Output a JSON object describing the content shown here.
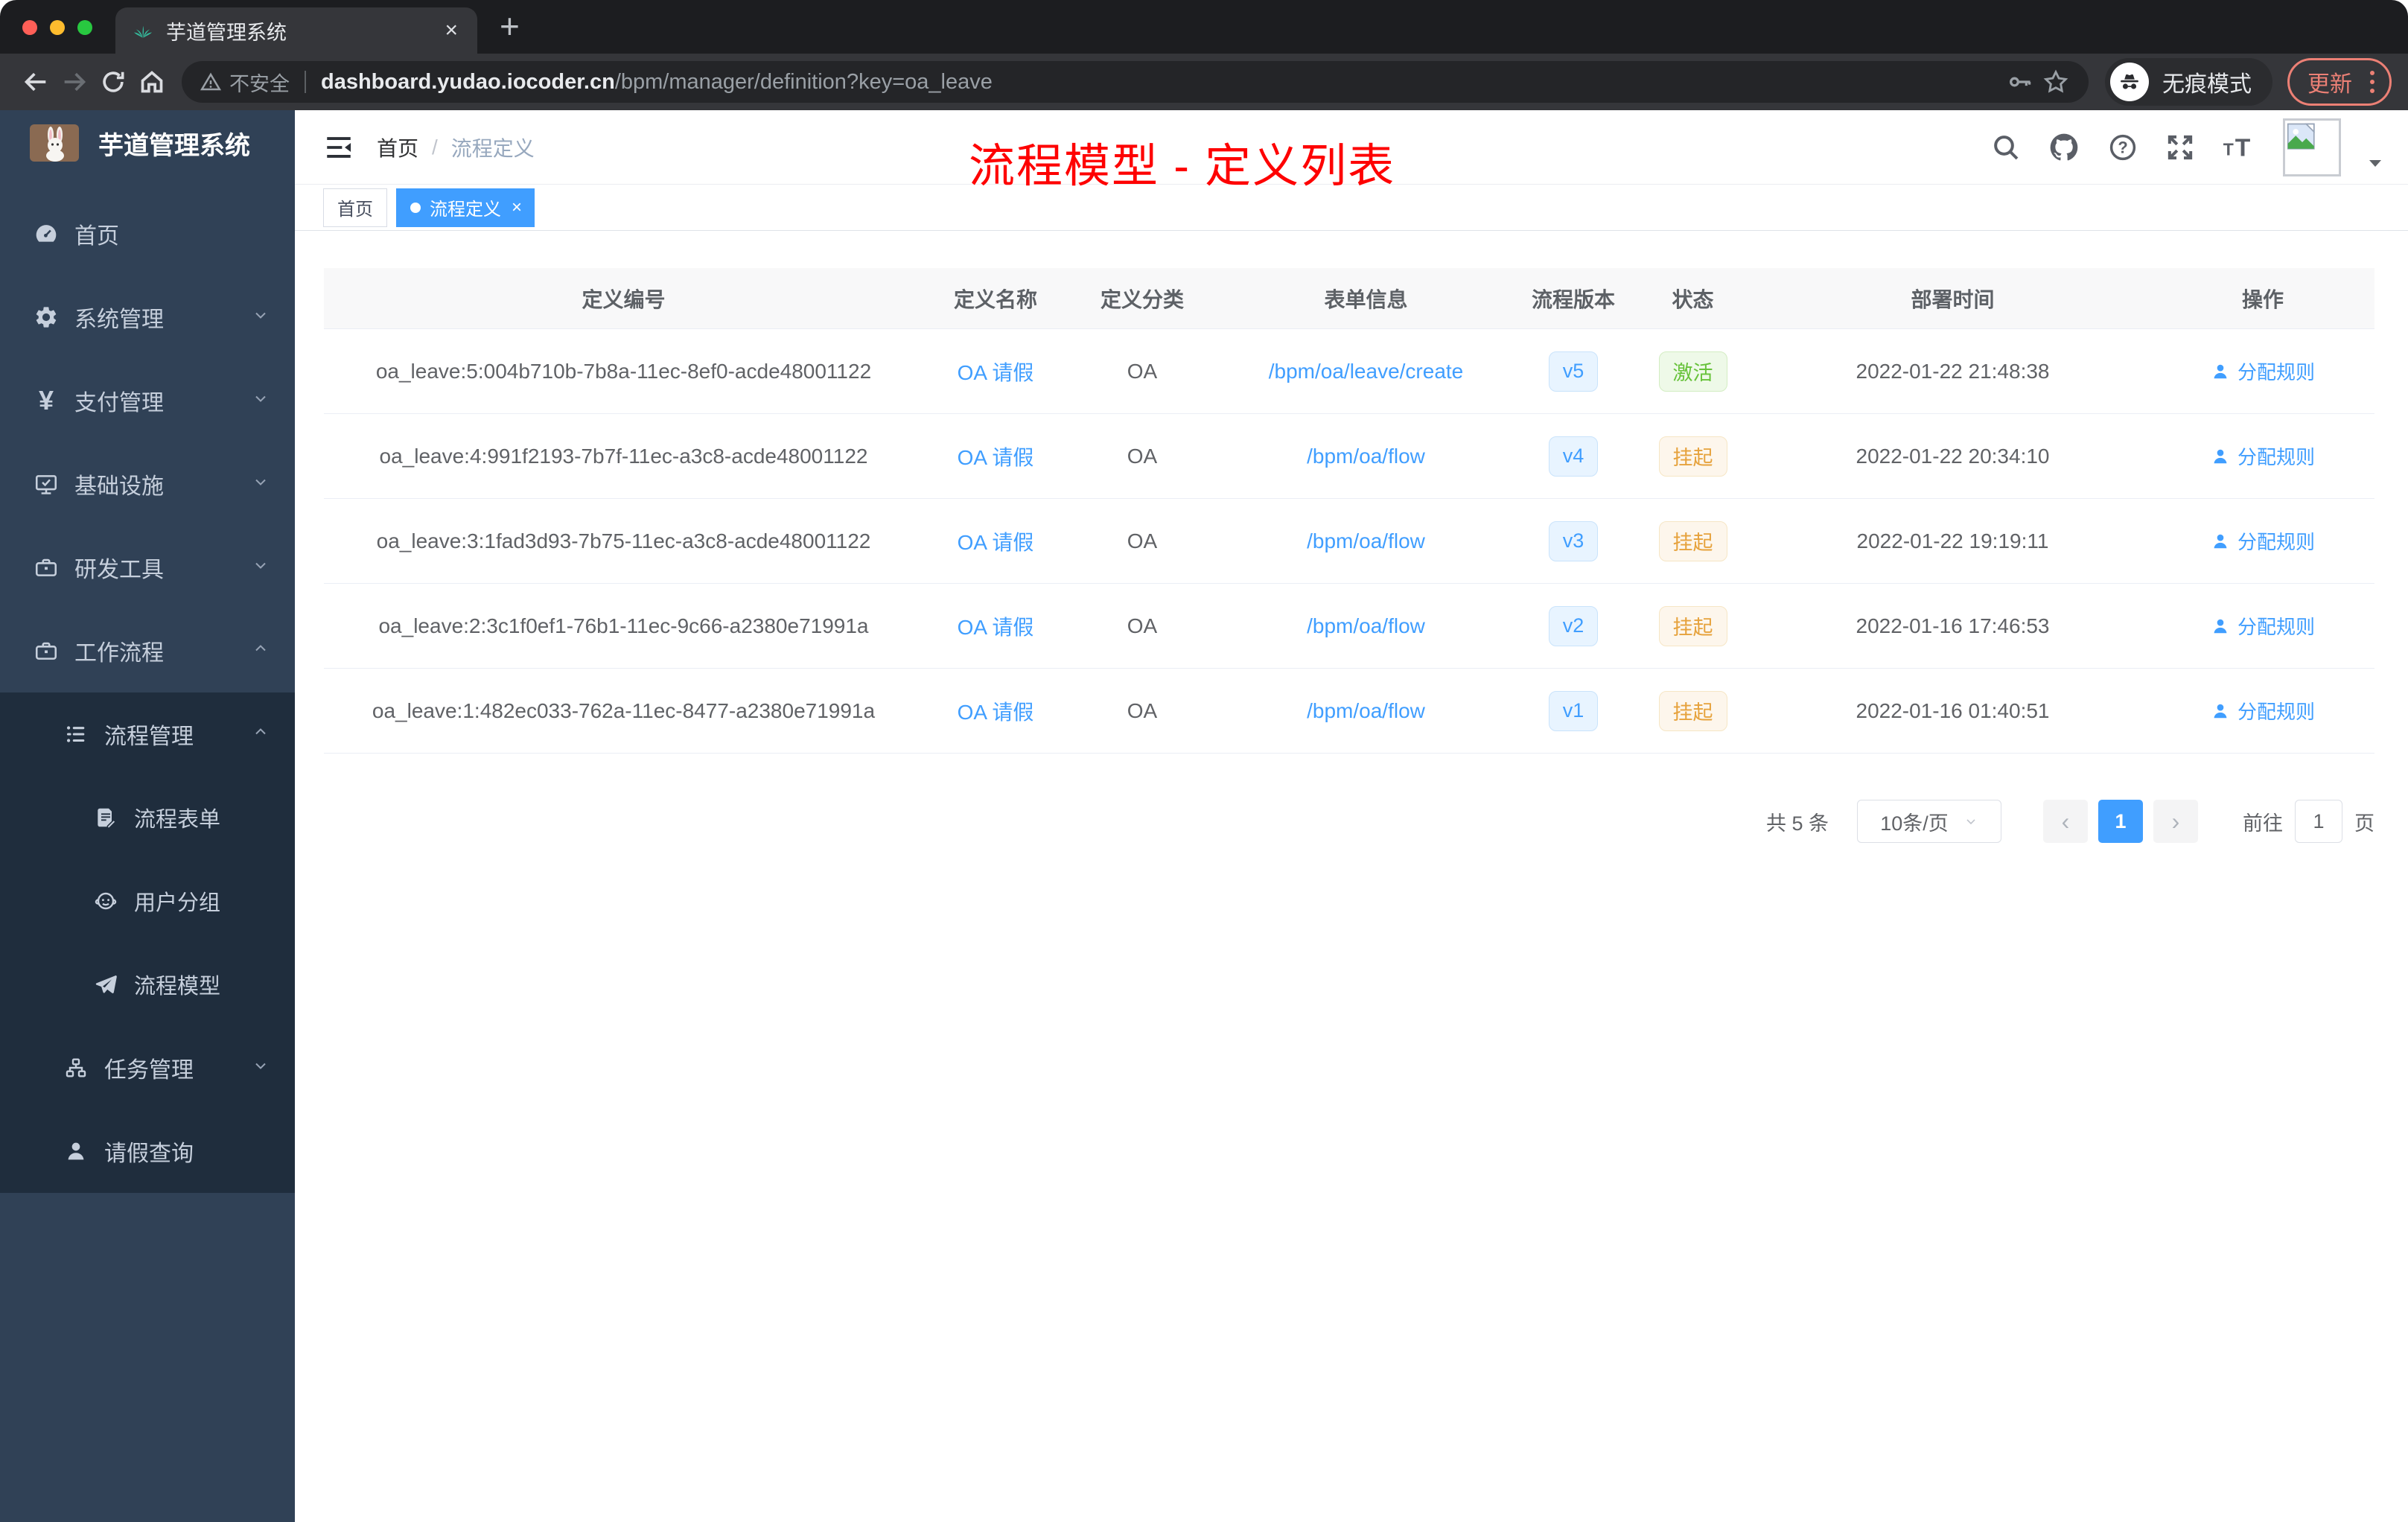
{
  "browser": {
    "tab_title": "芋道管理系统",
    "tab_close": "×",
    "new_tab": "+",
    "security_label": "不安全",
    "url_domain": "dashboard.yudao.iocoder.cn",
    "url_path": "/bpm/manager/definition?key=oa_leave",
    "incognito_label": "无痕模式",
    "update_label": "更新"
  },
  "sidebar": {
    "app_title": "芋道管理系统",
    "menu": [
      {
        "label": "首页",
        "icon": "dashboard-icon"
      },
      {
        "label": "系统管理",
        "icon": "gear-icon"
      },
      {
        "label": "支付管理",
        "icon": "yen-icon"
      },
      {
        "label": "基础设施",
        "icon": "monitor-icon"
      },
      {
        "label": "研发工具",
        "icon": "toolbox-icon"
      },
      {
        "label": "工作流程",
        "icon": "briefcase-icon"
      }
    ],
    "submenu": [
      {
        "label": "流程管理",
        "icon": "list-tree-icon"
      },
      {
        "label": "流程表单",
        "icon": "form-doc-icon"
      },
      {
        "label": "用户分组",
        "icon": "group-face-icon"
      },
      {
        "label": "流程模型",
        "icon": "paper-plane-icon"
      },
      {
        "label": "任务管理",
        "icon": "org-tree-icon"
      },
      {
        "label": "请假查询",
        "icon": "user-icon"
      }
    ]
  },
  "header": {
    "breadcrumb_home": "首页",
    "breadcrumb_separator": "/",
    "breadcrumb_current": "流程定义",
    "annotation": "流程模型 - 定义列表"
  },
  "tags": {
    "home": "首页",
    "active": "流程定义",
    "close": "×"
  },
  "table": {
    "columns": [
      "定义编号",
      "定义名称",
      "定义分类",
      "表单信息",
      "流程版本",
      "状态",
      "部署时间",
      "操作"
    ],
    "action_label": "分配规则",
    "rows": [
      {
        "id": "oa_leave:5:004b710b-7b8a-11ec-8ef0-acde48001122",
        "name": "OA 请假",
        "category": "OA",
        "form": "/bpm/oa/leave/create",
        "version": "v5",
        "status": "激活",
        "time": "2022-01-22 21:48:38"
      },
      {
        "id": "oa_leave:4:991f2193-7b7f-11ec-a3c8-acde48001122",
        "name": "OA 请假",
        "category": "OA",
        "form": "/bpm/oa/flow",
        "version": "v4",
        "status": "挂起",
        "time": "2022-01-22 20:34:10"
      },
      {
        "id": "oa_leave:3:1fad3d93-7b75-11ec-a3c8-acde48001122",
        "name": "OA 请假",
        "category": "OA",
        "form": "/bpm/oa/flow",
        "version": "v3",
        "status": "挂起",
        "time": "2022-01-22 19:19:11"
      },
      {
        "id": "oa_leave:2:3c1f0ef1-76b1-11ec-9c66-a2380e71991a",
        "name": "OA 请假",
        "category": "OA",
        "form": "/bpm/oa/flow",
        "version": "v2",
        "status": "挂起",
        "time": "2022-01-16 17:46:53"
      },
      {
        "id": "oa_leave:1:482ec033-762a-11ec-8477-a2380e71991a",
        "name": "OA 请假",
        "category": "OA",
        "form": "/bpm/oa/flow",
        "version": "v1",
        "status": "挂起",
        "time": "2022-01-16 01:40:51"
      }
    ]
  },
  "pagination": {
    "total": "共 5 条",
    "page_size": "10条/页",
    "prev": "‹",
    "page": "1",
    "next": "›",
    "goto_label": "前往",
    "goto_value": "1",
    "unit_label": "页"
  },
  "colors": {
    "primary": "#409eff",
    "success": "#67c23a",
    "warning": "#e6a23c",
    "annotation_red": "#fe0000",
    "sidebar_bg": "#304156",
    "submenu_bg": "#1f2d3d"
  }
}
